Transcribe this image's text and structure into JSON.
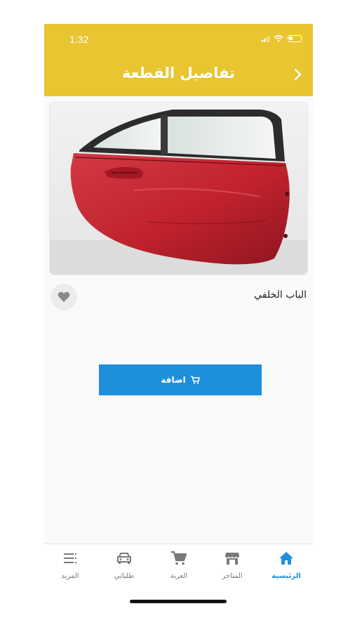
{
  "status_bar": {
    "time": "1:32"
  },
  "header": {
    "title": "تفاصيل القطعة"
  },
  "product": {
    "name": "الباب الخلفي"
  },
  "actions": {
    "add_label": "اضافة"
  },
  "nav": {
    "items": [
      {
        "label": "الرئيسية",
        "icon": "home-icon",
        "active": true
      },
      {
        "label": "المتاجر",
        "icon": "store-icon",
        "active": false
      },
      {
        "label": "العربة",
        "icon": "cart-icon",
        "active": false
      },
      {
        "label": "طلباتي",
        "icon": "car-icon",
        "active": false
      },
      {
        "label": "المزيد",
        "icon": "menu-icon",
        "active": false
      }
    ]
  },
  "colors": {
    "header": "#e8c531",
    "accent": "#1e8fdc"
  }
}
